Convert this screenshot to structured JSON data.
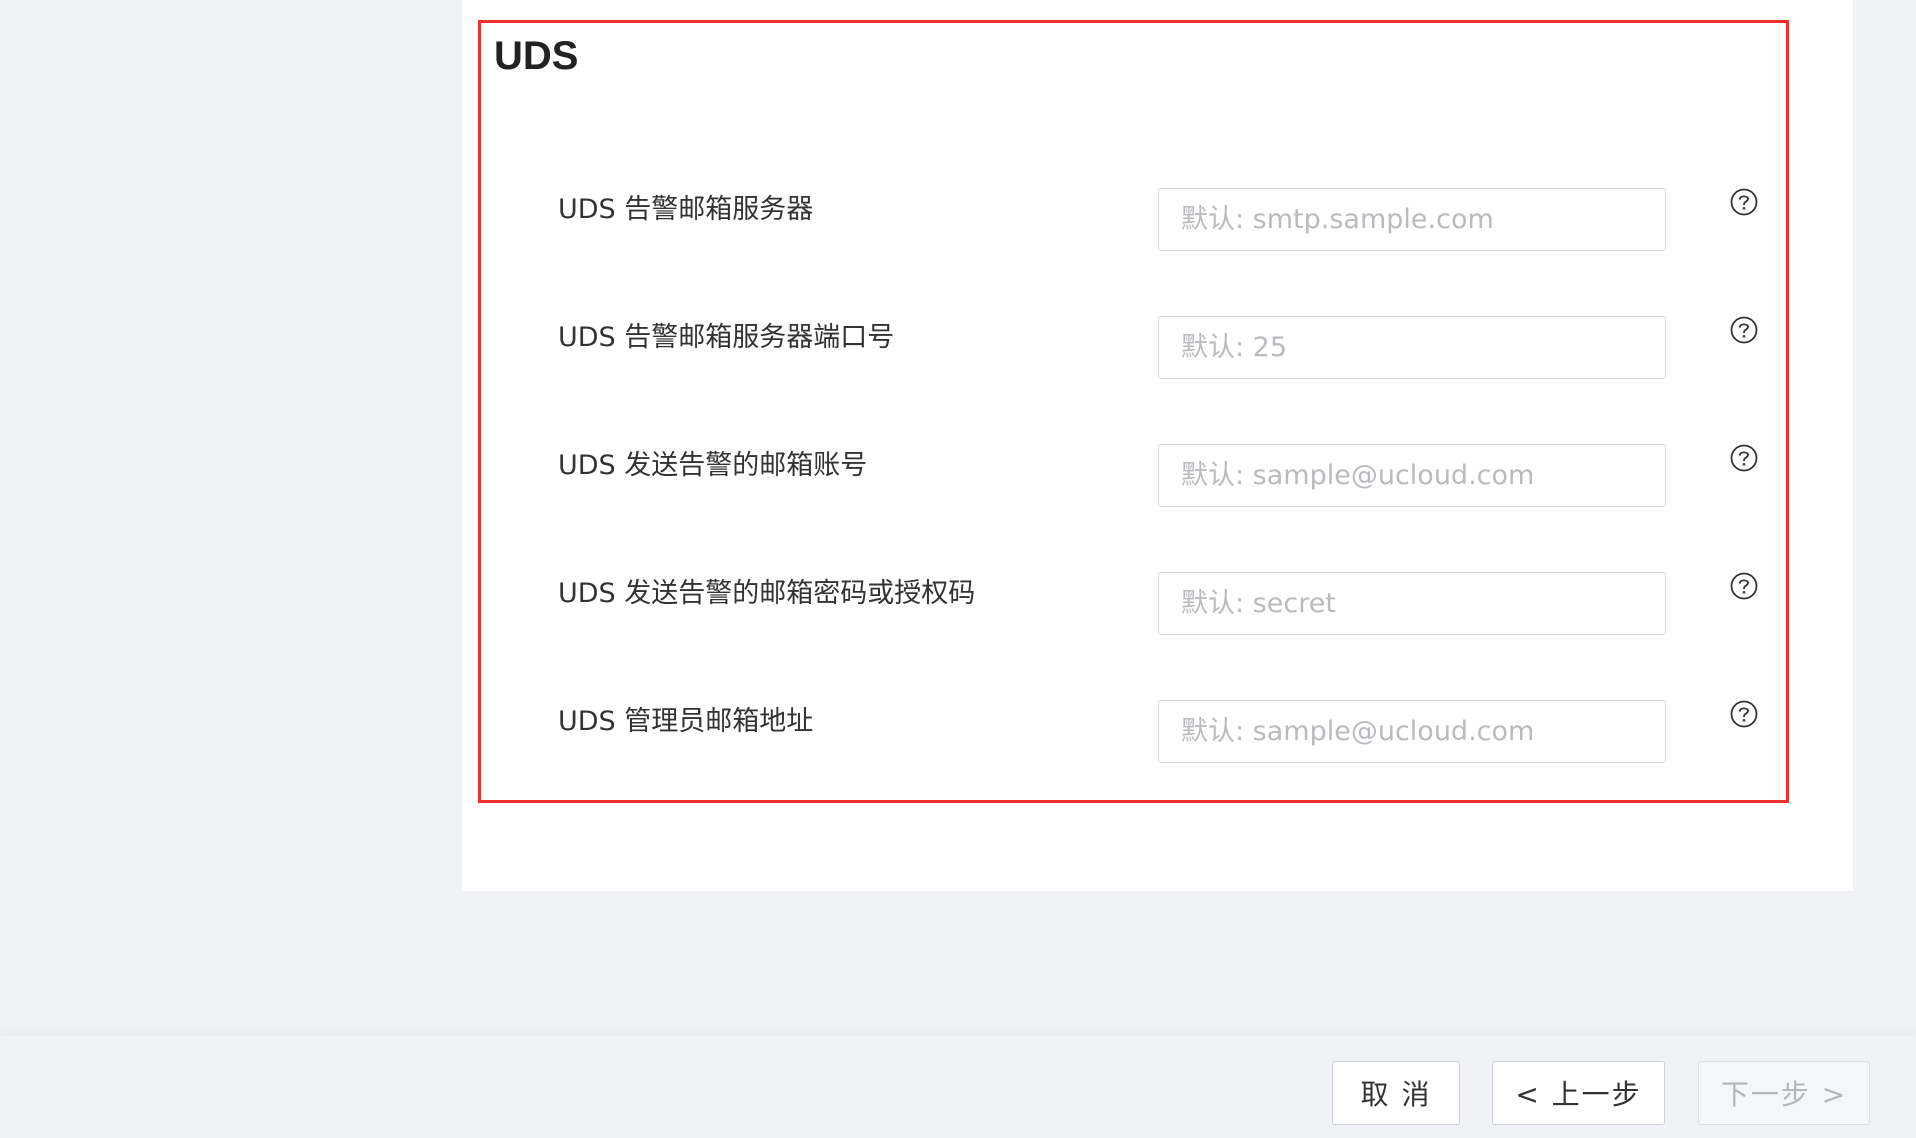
{
  "section": {
    "title": "UDS"
  },
  "fields": [
    {
      "label": "UDS 告警邮箱服务器",
      "placeholder": "默认: smtp.sample.com",
      "value": "",
      "icon": "question-circle-icon"
    },
    {
      "label": "UDS 告警邮箱服务器端口号",
      "placeholder": "默认: 25",
      "value": "",
      "icon": "question-circle-icon"
    },
    {
      "label": "UDS 发送告警的邮箱账号",
      "placeholder": "默认: sample@ucloud.com",
      "value": "",
      "icon": "question-circle-icon"
    },
    {
      "label": "UDS 发送告警的邮箱密码或授权码",
      "placeholder": "默认: secret",
      "value": "",
      "icon": "question-circle-icon"
    },
    {
      "label": "UDS 管理员邮箱地址",
      "placeholder": "默认: sample@ucloud.com",
      "value": "",
      "icon": "question-circle-icon"
    }
  ],
  "footer": {
    "cancel_label": "取 消",
    "prev_label": "< 上一步",
    "next_label": "下一步 >"
  },
  "colors": {
    "highlight_border": "#f0302a",
    "page_background": "#f0f2f5",
    "disabled_text": "#b4b6ba"
  }
}
